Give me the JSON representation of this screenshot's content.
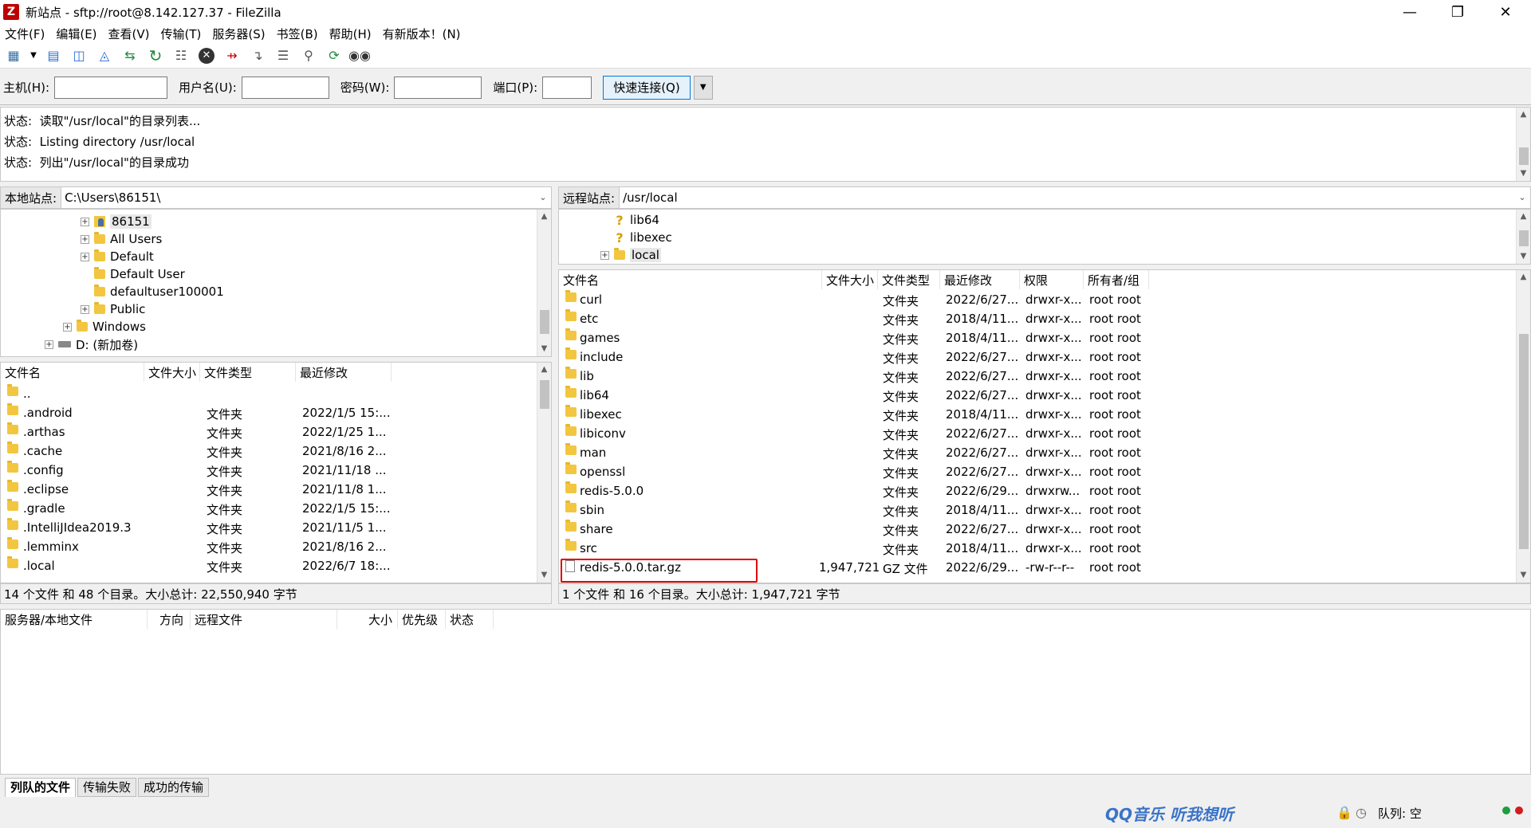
{
  "window": {
    "title": "新站点 - sftp://root@8.142.127.37 - FileZilla",
    "app_icon": "Z"
  },
  "menu": [
    "文件(F)",
    "编辑(E)",
    "查看(V)",
    "传输(T)",
    "服务器(S)",
    "书签(B)",
    "帮助(H)",
    "有新版本！(N)"
  ],
  "quickconnect": {
    "host_label": "主机(H):",
    "user_label": "用户名(U):",
    "pass_label": "密码(W):",
    "port_label": "端口(P):",
    "host_value": "",
    "user_value": "",
    "pass_value": "",
    "port_value": "",
    "connect_button": "快速连接(Q)"
  },
  "log": [
    {
      "label": "状态:",
      "text": "读取\"/usr/local\"的目录列表..."
    },
    {
      "label": "状态:",
      "text": "Listing directory /usr/local"
    },
    {
      "label": "状态:",
      "text": "列出\"/usr/local\"的目录成功"
    }
  ],
  "local": {
    "site_label": "本地站点:",
    "path": "C:\\Users\\86151\\",
    "tree": [
      {
        "name": "86151",
        "icon": "user-folder-icon"
      },
      {
        "name": "All Users",
        "icon": "folder-icon"
      },
      {
        "name": "Default",
        "icon": "folder-icon"
      },
      {
        "name": "Default User",
        "icon": "folder-icon"
      },
      {
        "name": "defaultuser100001",
        "icon": "folder-icon"
      },
      {
        "name": "Public",
        "icon": "folder-icon"
      },
      {
        "name": "Windows",
        "icon": "folder-icon"
      },
      {
        "name": "D: (新加卷)",
        "icon": "drive-icon"
      }
    ],
    "columns": [
      "文件名",
      "文件大小",
      "文件类型",
      "最近修改"
    ],
    "files": [
      {
        "name": "..",
        "size": "",
        "type": "",
        "modified": ""
      },
      {
        "name": ".android",
        "size": "",
        "type": "文件夹",
        "modified": "2022/1/5 15:..."
      },
      {
        "name": ".arthas",
        "size": "",
        "type": "文件夹",
        "modified": "2022/1/25 1..."
      },
      {
        "name": ".cache",
        "size": "",
        "type": "文件夹",
        "modified": "2021/8/16 2..."
      },
      {
        "name": ".config",
        "size": "",
        "type": "文件夹",
        "modified": "2021/11/18 ..."
      },
      {
        "name": ".eclipse",
        "size": "",
        "type": "文件夹",
        "modified": "2021/11/8 1..."
      },
      {
        "name": ".gradle",
        "size": "",
        "type": "文件夹",
        "modified": "2022/1/5 15:..."
      },
      {
        "name": ".IntelliJIdea2019.3",
        "size": "",
        "type": "文件夹",
        "modified": "2021/11/5 1..."
      },
      {
        "name": ".lemminx",
        "size": "",
        "type": "文件夹",
        "modified": "2021/8/16 2..."
      },
      {
        "name": ".local",
        "size": "",
        "type": "文件夹",
        "modified": "2022/6/7 18:..."
      }
    ],
    "status": "14 个文件 和 48 个目录。大小总计: 22,550,940 字节"
  },
  "remote": {
    "site_label": "远程站点:",
    "path": "/usr/local",
    "tree": [
      {
        "name": "lib64",
        "icon": "unknown-folder-icon"
      },
      {
        "name": "libexec",
        "icon": "unknown-folder-icon"
      },
      {
        "name": "local",
        "icon": "folder-icon"
      }
    ],
    "columns": [
      "文件名",
      "文件大小",
      "文件类型",
      "最近修改",
      "权限",
      "所有者/组"
    ],
    "files": [
      {
        "name": "curl",
        "size": "",
        "type": "文件夹",
        "modified": "2022/6/27...",
        "perm": "drwxr-x...",
        "owner": "root root"
      },
      {
        "name": "etc",
        "size": "",
        "type": "文件夹",
        "modified": "2018/4/11...",
        "perm": "drwxr-x...",
        "owner": "root root"
      },
      {
        "name": "games",
        "size": "",
        "type": "文件夹",
        "modified": "2018/4/11...",
        "perm": "drwxr-x...",
        "owner": "root root"
      },
      {
        "name": "include",
        "size": "",
        "type": "文件夹",
        "modified": "2022/6/27...",
        "perm": "drwxr-x...",
        "owner": "root root"
      },
      {
        "name": "lib",
        "size": "",
        "type": "文件夹",
        "modified": "2022/6/27...",
        "perm": "drwxr-x...",
        "owner": "root root"
      },
      {
        "name": "lib64",
        "size": "",
        "type": "文件夹",
        "modified": "2022/6/27...",
        "perm": "drwxr-x...",
        "owner": "root root"
      },
      {
        "name": "libexec",
        "size": "",
        "type": "文件夹",
        "modified": "2018/4/11...",
        "perm": "drwxr-x...",
        "owner": "root root"
      },
      {
        "name": "libiconv",
        "size": "",
        "type": "文件夹",
        "modified": "2022/6/27...",
        "perm": "drwxr-x...",
        "owner": "root root"
      },
      {
        "name": "man",
        "size": "",
        "type": "文件夹",
        "modified": "2022/6/27...",
        "perm": "drwxr-x...",
        "owner": "root root"
      },
      {
        "name": "openssl",
        "size": "",
        "type": "文件夹",
        "modified": "2022/6/27...",
        "perm": "drwxr-x...",
        "owner": "root root"
      },
      {
        "name": "redis-5.0.0",
        "size": "",
        "type": "文件夹",
        "modified": "2022/6/29...",
        "perm": "drwxrw...",
        "owner": "root root"
      },
      {
        "name": "sbin",
        "size": "",
        "type": "文件夹",
        "modified": "2018/4/11...",
        "perm": "drwxr-x...",
        "owner": "root root"
      },
      {
        "name": "share",
        "size": "",
        "type": "文件夹",
        "modified": "2022/6/27...",
        "perm": "drwxr-x...",
        "owner": "root root"
      },
      {
        "name": "src",
        "size": "",
        "type": "文件夹",
        "modified": "2018/4/11...",
        "perm": "drwxr-x...",
        "owner": "root root"
      },
      {
        "name": "redis-5.0.0.tar.gz",
        "size": "1,947,721",
        "type": "GZ 文件",
        "modified": "2022/6/29...",
        "perm": "-rw-r--r--",
        "owner": "root root",
        "is_file": true
      }
    ],
    "status": "1 个文件 和 16 个目录。大小总计: 1,947,721 字节"
  },
  "queue": {
    "columns": [
      "服务器/本地文件",
      "方向",
      "远程文件",
      "大小",
      "优先级",
      "状态"
    ]
  },
  "tabs": [
    "列队的文件",
    "传输失败",
    "成功的传输"
  ],
  "statusbar": {
    "queue": "队列: 空",
    "watermark": "QQ音乐 听我想听"
  },
  "colors": {
    "highlight": "#e00000",
    "folder": "#f3c640",
    "accent": "#0078d7"
  }
}
